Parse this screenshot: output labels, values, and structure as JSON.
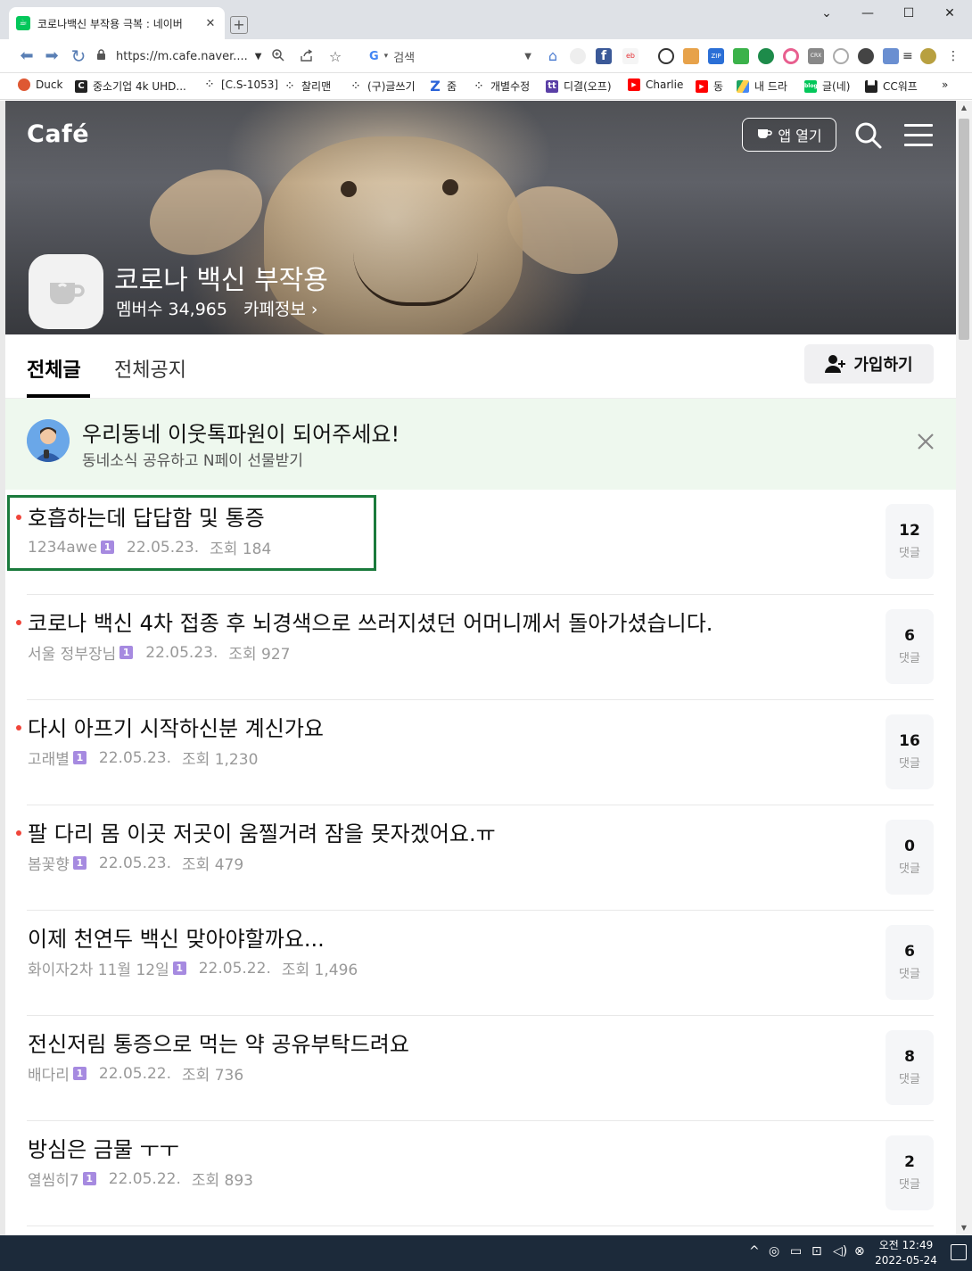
{
  "browser": {
    "tab_title": "코로나백신 부작용 극복 : 네이버",
    "tab_close": "✕",
    "new_tab": "+",
    "window_controls": {
      "minimize": "—",
      "maximize": "☐",
      "close": "✕",
      "dropdown": "⌄"
    },
    "url": "https://m.cafe.naver....",
    "search_placeholder": "검색",
    "bookmarks": [
      {
        "label": "Duck",
        "icon_color": "#de5833",
        "icon": "duck-icon"
      },
      {
        "label": "중소기업 4k UHD...",
        "icon_color": "#222222",
        "icon": "c-icon"
      },
      {
        "label": "[C.S-1053]",
        "icon_color": "#333333",
        "icon": "dots-icon"
      },
      {
        "label": "찰리맨",
        "icon_color": "#333333",
        "icon": "dots-icon"
      },
      {
        "label": "(구)글쓰기",
        "icon_color": "#333333",
        "icon": "dots-icon"
      },
      {
        "label": "줌",
        "icon_color": "#2a63d8",
        "icon": "z-icon"
      },
      {
        "label": "개별수정",
        "icon_color": "#333333",
        "icon": "dots-icon"
      },
      {
        "label": "디결(오프)",
        "icon_color": "#5a3fa6",
        "icon": "tt-icon"
      },
      {
        "label": "Charlie",
        "icon_color": "#ff0000",
        "icon": "youtube-icon"
      },
      {
        "label": "동",
        "icon_color": "#ff0000",
        "icon": "youtube-icon"
      },
      {
        "label": "내 드라",
        "icon_color": "#1fa463",
        "icon": "drive-icon"
      },
      {
        "label": "글(네)",
        "icon_color": "#03c75a",
        "icon": "blog-icon"
      },
      {
        "label": "CC워프",
        "icon_color": "#222222",
        "icon": "cc-icon"
      }
    ],
    "more_bookmarks": "»"
  },
  "cafe": {
    "logo": "Café",
    "app_open_label": "앱 열기",
    "name": "코로나 백신 부작용",
    "members_label": "멤버수 34,965",
    "info_label": "카페정보 ›"
  },
  "tabs": {
    "all_posts": "전체글",
    "all_notices": "전체공지",
    "join_label": "가입하기"
  },
  "banner": {
    "title": "우리동네 이웃톡파원이 되어주세요!",
    "subtitle": "동네소식 공유하고 N페이 선물받기"
  },
  "posts": [
    {
      "title": "호흡하는데 답답함 및 통증",
      "author": "1234awe",
      "date": "22.05.23.",
      "views": "조회 184",
      "comments": "12",
      "comments_label": "댓글",
      "new": true
    },
    {
      "title": "코로나 백신 4차 접종 후 뇌경색으로 쓰러지셨던 어머니께서 돌아가셨습니다.",
      "author": "서울 정부장님",
      "date": "22.05.23.",
      "views": "조회 927",
      "comments": "6",
      "comments_label": "댓글",
      "new": true
    },
    {
      "title": "다시 아프기 시작하신분 계신가요",
      "author": "고래별",
      "date": "22.05.23.",
      "views": "조회 1,230",
      "comments": "16",
      "comments_label": "댓글",
      "new": true
    },
    {
      "title": "팔 다리 몸 이곳 저곳이 움찔거려 잠을 못자겠어요.ㅠ",
      "author": "봄꽃향",
      "date": "22.05.23.",
      "views": "조회 479",
      "comments": "0",
      "comments_label": "댓글",
      "new": true
    },
    {
      "title": "이제 천연두 백신 맞아야할까요...",
      "author": "화이자2차 11월 12일",
      "date": "22.05.22.",
      "views": "조회 1,496",
      "comments": "6",
      "comments_label": "댓글",
      "new": false
    },
    {
      "title": "전신저림 통증으로 먹는 약 공유부탁드려요",
      "author": "배다리",
      "date": "22.05.22.",
      "views": "조회 736",
      "comments": "8",
      "comments_label": "댓글",
      "new": false
    },
    {
      "title": "방심은 금물 ㅜㅜ",
      "author": "열씸히7",
      "date": "22.05.22.",
      "views": "조회 893",
      "comments": "2",
      "comments_label": "댓글",
      "new": false
    }
  ],
  "level_badge": "1",
  "taskbar": {
    "clock_time": "오전 12:49",
    "clock_date": "2022-05-24"
  },
  "colors": {
    "naver_green": "#03c75a",
    "new_dot": "#f0453a",
    "highlight_border": "#1a7a3c",
    "level_badge": "#a68ae0"
  }
}
